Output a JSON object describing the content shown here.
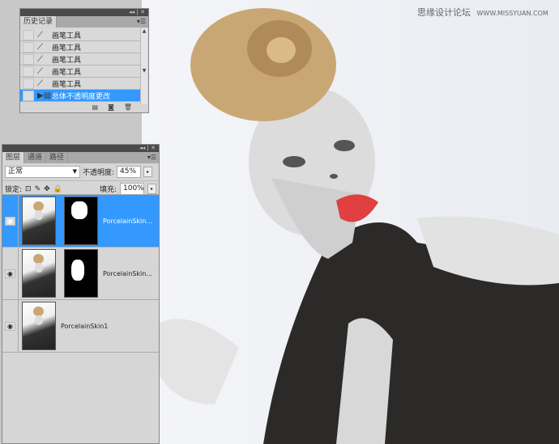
{
  "watermark": {
    "site_cn": "思缘设计论坛",
    "site_url": "WWW.MISSYUAN.COM"
  },
  "history_panel": {
    "tab": "历史记录",
    "items": [
      {
        "label": "画笔工具",
        "icon": "brush-icon"
      },
      {
        "label": "画笔工具",
        "icon": "brush-icon"
      },
      {
        "label": "画笔工具",
        "icon": "brush-icon"
      },
      {
        "label": "画笔工具",
        "icon": "brush-icon"
      },
      {
        "label": "画笔工具",
        "icon": "brush-icon"
      },
      {
        "label": "总体不透明度更改",
        "icon": "history-state-icon",
        "selected": true
      }
    ]
  },
  "layers_panel": {
    "tabs": [
      "图层",
      "通道",
      "路径"
    ],
    "blend_mode": "正常",
    "opacity_label": "不透明度:",
    "opacity": "45%",
    "lock_label": "锁定:",
    "fill_label": "填充:",
    "fill": "100%",
    "layers": [
      {
        "name": "PorcelainSkin...",
        "mask": true,
        "selected": true
      },
      {
        "name": "PorcelainSkin...",
        "mask": true,
        "selected": false
      },
      {
        "name": "PorcelainSkin1",
        "mask": false,
        "selected": false
      }
    ]
  },
  "colors": {
    "selection": "#3399ff",
    "lips": "#e04040",
    "hair": "#c9a775"
  }
}
